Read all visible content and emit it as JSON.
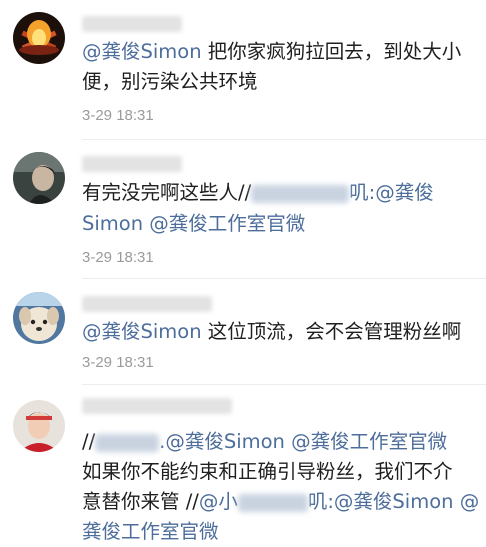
{
  "comments": [
    {
      "lines": [
        [
          {
            "t": "m",
            "v": "@龚俊Simon"
          },
          {
            "t": "x",
            "v": " 把你家疯狗拉回去，到处大小"
          }
        ],
        [
          {
            "t": "x",
            "v": "便，别污染公共环境"
          }
        ]
      ],
      "time": "3-29 18:31"
    },
    {
      "lines": [
        [
          {
            "t": "x",
            "v": "有完没完啊这些人//"
          },
          {
            "t": "b",
            "w": 98
          },
          {
            "t": "m",
            "v": "叽:@龚俊"
          }
        ],
        [
          {
            "t": "m",
            "v": "Simon @龚俊工作室官微"
          }
        ]
      ],
      "time": "3-29 18:31"
    },
    {
      "lines": [
        [
          {
            "t": "m",
            "v": "@龚俊Simon"
          },
          {
            "t": "x",
            "v": " 这位顶流，会不会管理粉丝啊"
          }
        ]
      ],
      "time": "3-29 18:31"
    },
    {
      "lines": [
        [
          {
            "t": "x",
            "v": "//"
          },
          {
            "t": "b",
            "w": 64
          },
          {
            "t": "m",
            "v": ".@龚俊Simon @龚俊工作室官微"
          }
        ],
        [
          {
            "t": "x",
            "v": "如果你不能约束和正确引导粉丝，我们不介"
          }
        ],
        [
          {
            "t": "x",
            "v": "意替你来管 //"
          },
          {
            "t": "m",
            "v": "@小"
          },
          {
            "t": "b",
            "w": 70
          },
          {
            "t": "m",
            "v": "叽:@龚俊Simon @"
          }
        ],
        [
          {
            "t": "m",
            "v": "龚俊工作室官微"
          }
        ]
      ],
      "time": ""
    }
  ]
}
